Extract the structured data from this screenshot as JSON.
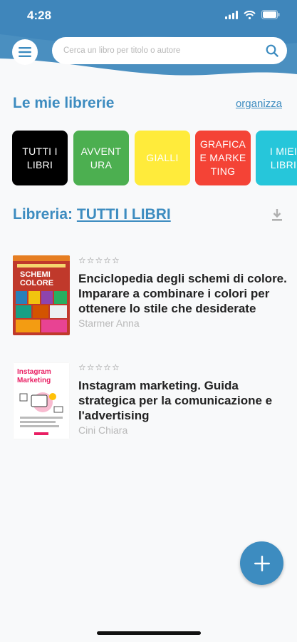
{
  "status_bar": {
    "time": "4:28"
  },
  "search": {
    "placeholder": "Cerca un libro per titolo o autore"
  },
  "libraries": {
    "title": "Le mie librerie",
    "organize_label": "organizza",
    "chips": [
      {
        "label": "TUTTI I LIBRI",
        "color": "#000000"
      },
      {
        "label": "AVVENTURA",
        "color": "#4caf50"
      },
      {
        "label": "GIALLI",
        "color": "#ffeb3b"
      },
      {
        "label": "GRAFICA E MARKETING",
        "color": "#f44336"
      },
      {
        "label": "I MIEI LIBRI",
        "color": "#26c6da"
      }
    ]
  },
  "current_library": {
    "prefix": "Libreria:",
    "name": "TUTTI I LIBRI"
  },
  "books": [
    {
      "stars": "☆☆☆☆☆",
      "title": "Enciclopedia degli schemi di colore. Imparare a combinare i colori per ottenere lo stile che desiderate",
      "author": "Starmer Anna"
    },
    {
      "stars": "☆☆☆☆☆",
      "title": "Instagram marketing. Guida strategica per la comunicazione e l'advertising",
      "author": "Cini Chiara"
    }
  ],
  "colors": {
    "accent": "#3d8cc0",
    "header": "#4a90c0"
  }
}
